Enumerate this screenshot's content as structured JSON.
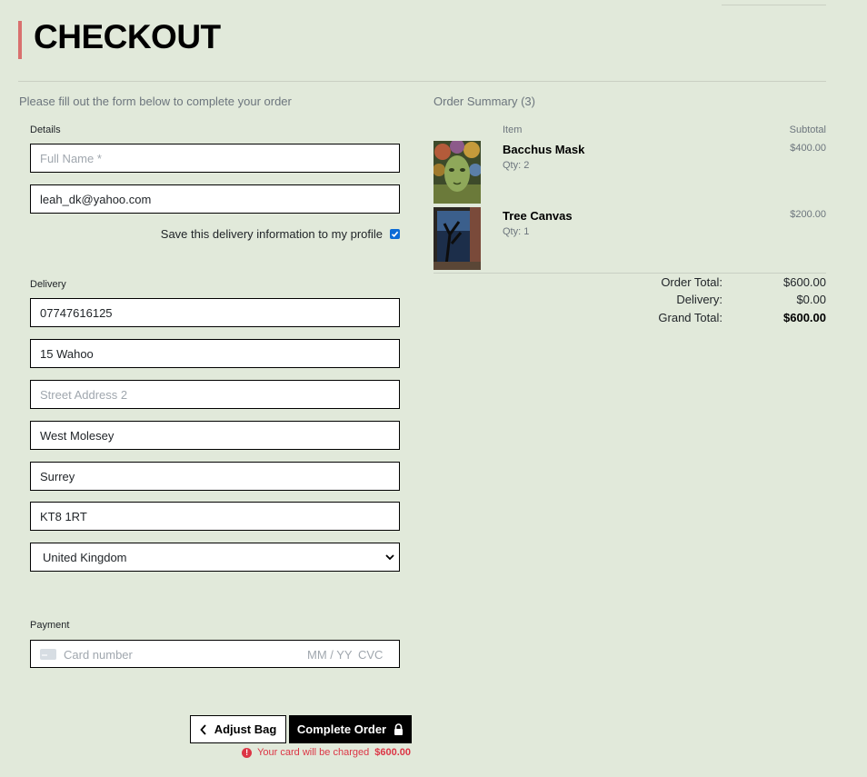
{
  "page_title": "CHECKOUT",
  "instructions": "Please fill out the form below to complete your order",
  "details": {
    "label": "Details",
    "full_name_placeholder": "Full Name *",
    "full_name_value": "",
    "email_value": "leah_dk@yahoo.com",
    "save_label": "Save this delivery information to my profile",
    "save_checked": true
  },
  "delivery": {
    "label": "Delivery",
    "phone": "07747616125",
    "street1": "15 Wahoo",
    "street2_placeholder": "Street Address 2",
    "town": "West Molesey",
    "county": "Surrey",
    "postcode": "KT8 1RT",
    "country": "United Kingdom"
  },
  "payment": {
    "label": "Payment",
    "card_placeholder": "Card number",
    "date_placeholder": "MM / YY",
    "cvc_placeholder": "CVC"
  },
  "actions": {
    "adjust_label": "Adjust Bag",
    "complete_label": "Complete Order",
    "charge_prefix": "Your card will be charged",
    "charge_amount": "$600.00"
  },
  "summary": {
    "title": "Order Summary (3)",
    "col_item": "Item",
    "col_subtotal": "Subtotal",
    "items": [
      {
        "name": "Bacchus Mask",
        "qty": "Qty: 2",
        "subtotal": "$400.00"
      },
      {
        "name": "Tree Canvas",
        "qty": "Qty: 1",
        "subtotal": "$200.00"
      }
    ],
    "order_total_label": "Order Total:",
    "order_total": "$600.00",
    "delivery_label": "Delivery:",
    "delivery_cost": "$0.00",
    "grand_total_label": "Grand Total:",
    "grand_total": "$600.00"
  },
  "colors": {
    "background": "#e1e9da",
    "accent_bar": "#d9706e",
    "error": "#dc3545",
    "checkbox": "#0b6bd6"
  }
}
